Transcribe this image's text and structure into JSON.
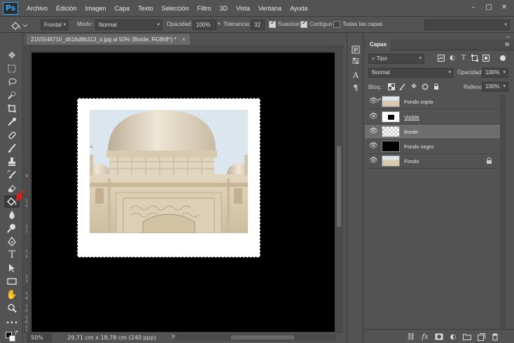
{
  "app": {
    "logo": "Ps"
  },
  "menu": [
    "Archivo",
    "Edición",
    "Imagen",
    "Capa",
    "Texto",
    "Selección",
    "Filtro",
    "3D",
    "Vista",
    "Ventana",
    "Ayuda"
  ],
  "window_controls": {
    "minimize": "–",
    "maximize": "□",
    "close": "✕"
  },
  "options": {
    "tool_preset": "Frontal",
    "mode_label": "Modo:",
    "mode_value": "Normal",
    "opacity_label": "Opacidad:",
    "opacity_value": "100%",
    "tolerance_label": "Tolerancia:",
    "tolerance_value": "32",
    "smooth_label": "Suavizar",
    "smooth_checked": true,
    "contiguous_label": "Contiguo",
    "contiguous_checked": true,
    "all_layers_label": "Todas las capas",
    "all_layers_checked": false
  },
  "document": {
    "tab_title": "2155546710_d616d9b313_o.jpg al 50% (Borde, RGB/8*) *",
    "tab_close": "×"
  },
  "status": {
    "zoom": "50%",
    "info": "29,71 cm x 19,78 cm (240 ppp)",
    "arrow": ">"
  },
  "ruler_marks": [
    "9",
    "1\n0",
    "1\n1",
    "1\n2",
    "1\n3",
    "1\n4",
    "1\n5",
    "1\n6",
    "1\n7"
  ],
  "layers_panel": {
    "title": "Capas",
    "filter_value": "Tipo",
    "blend_mode": "Normal",
    "opacity_label": "Opacidad:",
    "opacity_value": "100%",
    "lock_label": "Bloq.:",
    "fill_label": "Relleno:",
    "fill_value": "100%",
    "layers": [
      {
        "name": "Fondo copia",
        "visible": true,
        "selected": false,
        "linked": true,
        "locked": false
      },
      {
        "name": "Visible",
        "visible": true,
        "selected": false,
        "linked": false,
        "locked": false
      },
      {
        "name": "Borde",
        "visible": true,
        "selected": true,
        "linked": false,
        "locked": false
      },
      {
        "name": "Fondo negro",
        "visible": true,
        "selected": false,
        "linked": false,
        "locked": false
      },
      {
        "name": "Fondo",
        "visible": true,
        "selected": false,
        "linked": false,
        "locked": true
      }
    ]
  },
  "colors": {
    "ui_bg": "#535353",
    "ui_dark": "#3a3a3a",
    "selected_row": "#6d6d6d",
    "canvas_bg": "#000000",
    "annotation_arrow": "#e01b1b",
    "ps_accent": "#31a8ff"
  }
}
